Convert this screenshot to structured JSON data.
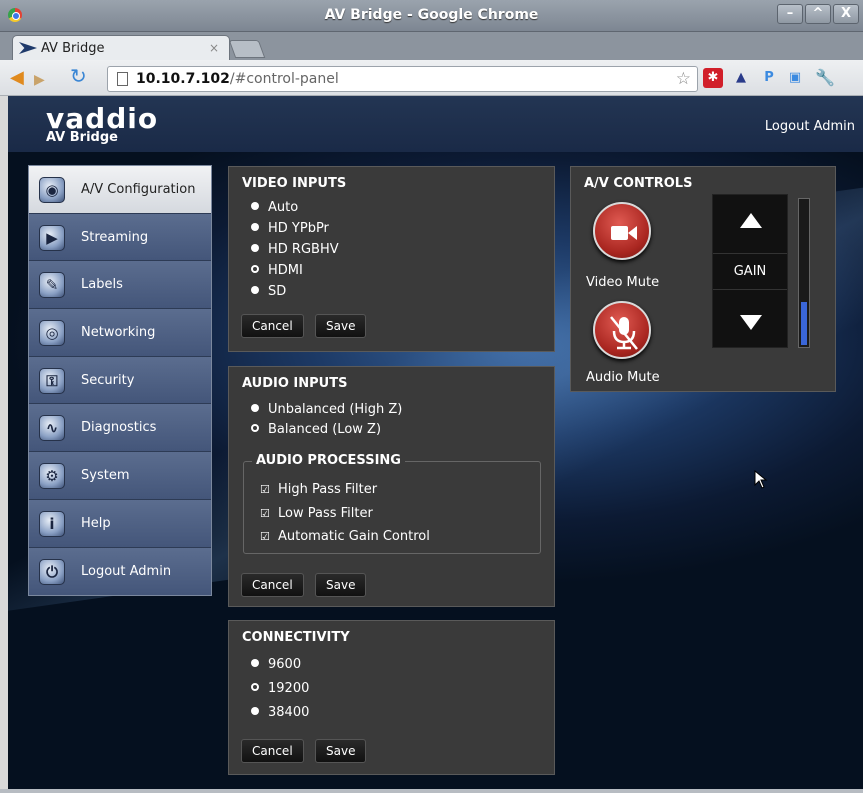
{
  "window": {
    "title": "AV Bridge - Google Chrome",
    "buttons": [
      "–",
      "^",
      "X"
    ]
  },
  "tab": {
    "label": "AV Bridge",
    "close": "×"
  },
  "toolbar": {
    "url_host": "10.10.7.102",
    "url_path": "/#control-panel"
  },
  "extensions": [
    {
      "name": "red-cross-extension-icon",
      "glyph": "✱",
      "color": "#d11f2a"
    },
    {
      "name": "bookmark-app-icon",
      "glyph": "▲",
      "color": "#2a3b8a"
    },
    {
      "name": "pinterest-icon",
      "glyph": "P",
      "color": "#3b8ae0"
    },
    {
      "name": "screen-capture-icon",
      "glyph": "▣",
      "color": "#3b8ae0"
    }
  ],
  "header": {
    "logo": "vaddio",
    "product": "AV Bridge",
    "logout": "Logout Admin"
  },
  "sidebar": {
    "items": [
      {
        "label": "A/V Configuration",
        "icon": "camera-icon",
        "active": true
      },
      {
        "label": "Streaming",
        "icon": "streaming-icon",
        "active": false
      },
      {
        "label": "Labels",
        "icon": "labels-icon",
        "active": false
      },
      {
        "label": "Networking",
        "icon": "networking-icon",
        "active": false
      },
      {
        "label": "Security",
        "icon": "lock-icon",
        "active": false
      },
      {
        "label": "Diagnostics",
        "icon": "diagnostics-icon",
        "active": false
      },
      {
        "label": "System",
        "icon": "system-icon",
        "active": false
      },
      {
        "label": "Help",
        "icon": "help-icon",
        "active": false
      },
      {
        "label": "Logout Admin",
        "icon": "power-icon",
        "active": false
      }
    ]
  },
  "video_inputs": {
    "title": "VIDEO INPUTS",
    "options": [
      "Auto",
      "HD YPbPr",
      "HD RGBHV",
      "HDMI",
      "SD"
    ],
    "selected": "HDMI",
    "cancel": "Cancel",
    "save": "Save"
  },
  "audio_inputs": {
    "title": "AUDIO INPUTS",
    "options": [
      "Unbalanced (High Z)",
      "Balanced (Low Z)"
    ],
    "selected": "Balanced (Low Z)",
    "processing_title": "AUDIO PROCESSING",
    "processing": [
      "High Pass Filter",
      "Low Pass Filter",
      "Automatic Gain Control"
    ],
    "cancel": "Cancel",
    "save": "Save"
  },
  "connectivity": {
    "title": "CONNECTIVITY",
    "options": [
      "9600",
      "19200",
      "38400"
    ],
    "selected": "19200",
    "cancel": "Cancel",
    "save": "Save"
  },
  "av_controls": {
    "title": "A/V CONTROLS",
    "video_mute": "Video Mute",
    "audio_mute": "Audio Mute",
    "gain": "GAIN",
    "meter_level": 0.3
  }
}
